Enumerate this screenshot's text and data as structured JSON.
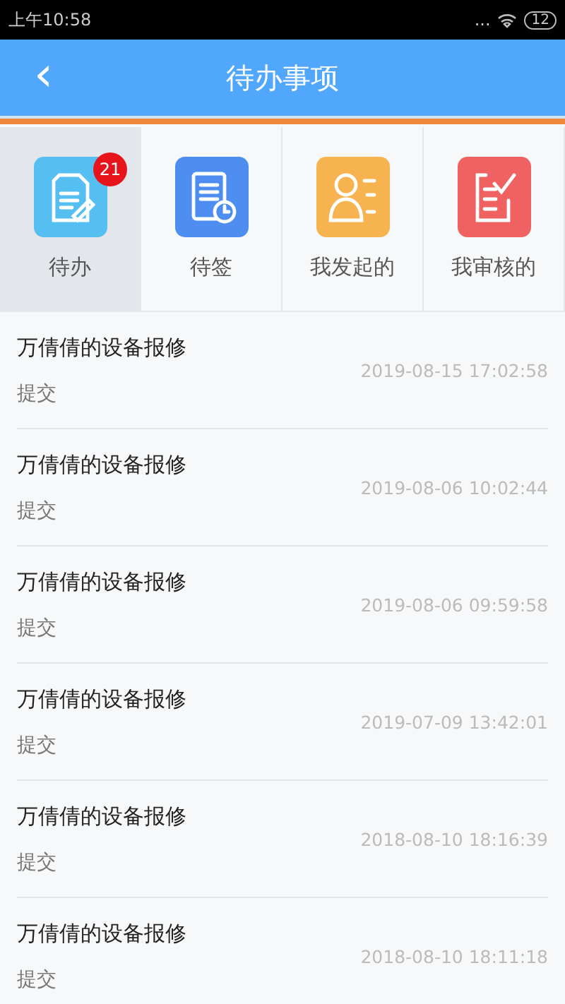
{
  "status_bar": {
    "time": "上午10:58",
    "dots": "...",
    "battery": "12"
  },
  "header": {
    "back": "‹",
    "title": "待办事项"
  },
  "tabs": [
    {
      "label": "待办",
      "kind": "edit",
      "selected": true,
      "badge": "21"
    },
    {
      "label": "待签",
      "kind": "clock",
      "selected": false
    },
    {
      "label": "我发起的",
      "kind": "person",
      "selected": false
    },
    {
      "label": "我审核的",
      "kind": "check",
      "selected": false
    }
  ],
  "items": [
    {
      "title": "万倩倩的设备报修",
      "status": "提交",
      "time": "2019-08-15 17:02:58"
    },
    {
      "title": "万倩倩的设备报修",
      "status": "提交",
      "time": "2019-08-06 10:02:44"
    },
    {
      "title": "万倩倩的设备报修",
      "status": "提交",
      "time": "2019-08-06 09:59:58"
    },
    {
      "title": "万倩倩的设备报修",
      "status": "提交",
      "time": "2019-07-09 13:42:01"
    },
    {
      "title": "万倩倩的设备报修",
      "status": "提交",
      "time": "2018-08-10 18:16:39"
    },
    {
      "title": "万倩倩的设备报修",
      "status": "提交",
      "time": "2018-08-10 18:11:18"
    }
  ]
}
